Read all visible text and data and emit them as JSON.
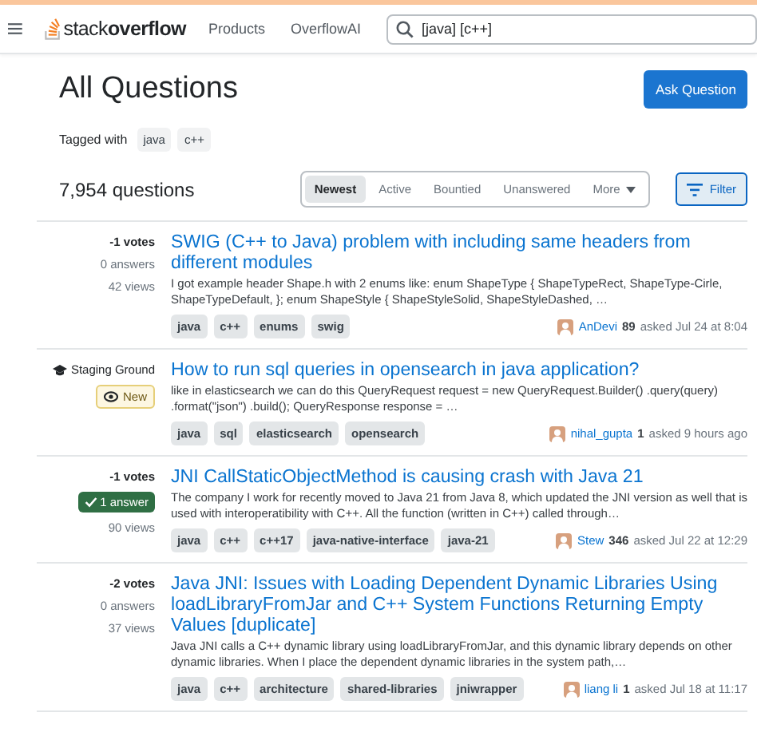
{
  "header": {
    "logo": "stack**overflow**",
    "nav": [
      "Products",
      "OverflowAI"
    ],
    "search": {
      "value": "[java] [c++]"
    }
  },
  "page": {
    "title": "All Questions",
    "ask_button": "Ask Question",
    "tagged_label": "Tagged with",
    "tagged": [
      "java",
      "c++"
    ],
    "count": "7,954 questions",
    "sort_tabs": [
      {
        "label": "Newest",
        "selected": true
      },
      {
        "label": "Active",
        "selected": false
      },
      {
        "label": "Bountied",
        "selected": false
      },
      {
        "label": "Unanswered",
        "selected": false
      },
      {
        "label": "More",
        "selected": false,
        "kind": "menu"
      }
    ],
    "filter_button": "Filter"
  },
  "questions": [
    {
      "kind": "normal",
      "votes": "-1 votes",
      "answers": "0 answers",
      "accepted": false,
      "views": "42 views",
      "title": "SWIG (C++ to Java) problem with including same headers from different modules",
      "excerpt": "I got example header Shape.h with 2 enums like: enum ShapeType { ShapeTypeRect, ShapeType-Cirle, ShapeTypeDefault, }; enum ShapeStyle { ShapeStyleSolid, ShapeStyleDashed, …",
      "tags": [
        "java",
        "c++",
        "enums",
        "swig"
      ],
      "user": "AnDevi",
      "rep": "89",
      "asked": "asked Jul 24 at 8:04"
    },
    {
      "kind": "staging",
      "staging_label": "Staging Ground",
      "badge": "New",
      "title": "How to run sql queries in opensearch in java application?",
      "excerpt": "like in elasticsearch we can do this QueryRequest request = new QueryRequest.Builder() .query(query) .format(\"json\") .build(); QueryResponse response = …",
      "tags": [
        "java",
        "sql",
        "elasticsearch",
        "opensearch"
      ],
      "user": "nihal_gupta",
      "rep": "1",
      "asked": "asked 9 hours ago"
    },
    {
      "kind": "normal",
      "votes": "-1 votes",
      "answers": "1 answer",
      "accepted": true,
      "views": "90 views",
      "title": "JNI CallStaticObjectMethod is causing crash with Java 21",
      "excerpt": "The company I work for recently moved to Java 21 from Java 8, which updated the JNI version as well that is used with interoperatibility with C++. All the function (written in C++) called through…",
      "tags": [
        "java",
        "c++",
        "c++17",
        "java-native-interface",
        "java-21"
      ],
      "user": "Stew",
      "rep": "346",
      "asked": "asked Jul 22 at 12:29"
    },
    {
      "kind": "normal",
      "votes": "-2 votes",
      "answers": "0 answers",
      "accepted": false,
      "views": "37 views",
      "title": "Java JNI: Issues with Loading Dependent Dynamic Libraries Using loadLibraryFromJar and C++ System Functions Returning Empty Values [duplicate]",
      "excerpt": "Java JNI calls a C++ dynamic library using loadLibraryFromJar, and this dynamic library depends on other dynamic libraries. When I place the dependent dynamic libraries in the system path,…",
      "tags": [
        "java",
        "c++",
        "architecture",
        "shared-libraries",
        "jniwrapper"
      ],
      "user": "liang li",
      "rep": "1",
      "asked": "asked Jul 18 at 11:17"
    }
  ]
}
